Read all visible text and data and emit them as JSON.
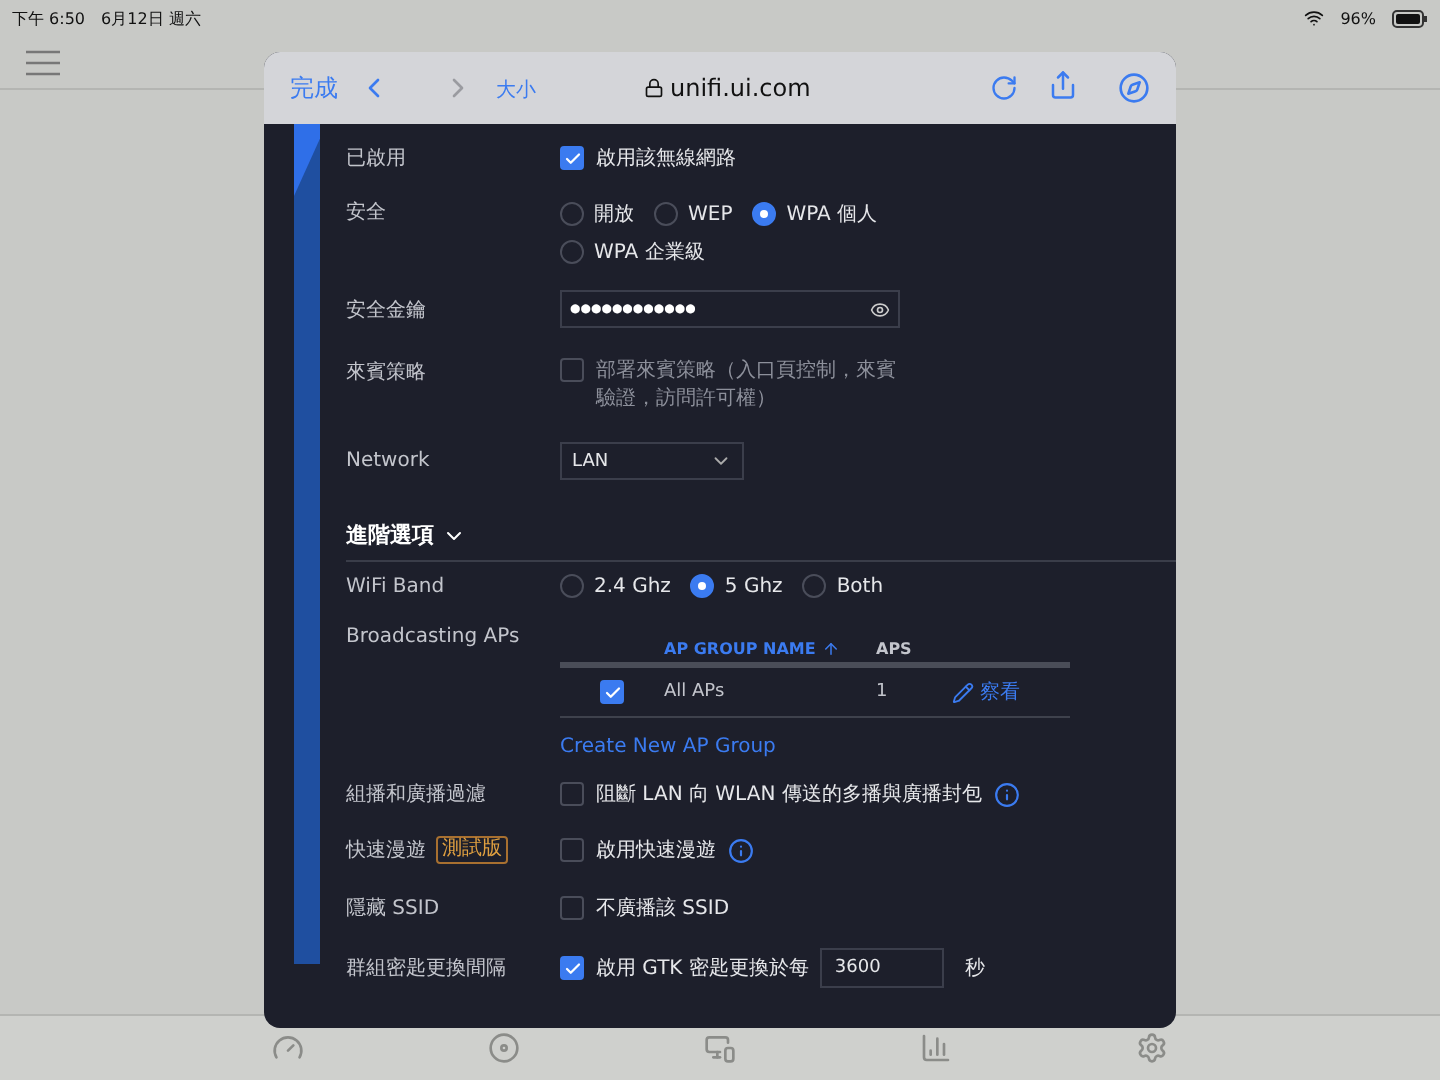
{
  "status_bar": {
    "time": "下午 6:50",
    "date": "6月12日 週六",
    "battery": "96%"
  },
  "browser": {
    "done": "完成",
    "text_size": "大小",
    "url": "unifi.ui.com"
  },
  "enabled": {
    "label": "已啟用",
    "option": "啟用該無線網路",
    "checked": true
  },
  "security": {
    "label": "安全",
    "options": [
      {
        "label": "開放",
        "selected": false
      },
      {
        "label": "WEP",
        "selected": false
      },
      {
        "label": "WPA 個人",
        "selected": true
      },
      {
        "label": "WPA 企業級",
        "selected": false
      }
    ]
  },
  "security_key": {
    "label": "安全金鑰",
    "value": "●●●●●●●●●●●●"
  },
  "guest_policy": {
    "label": "來賓策略",
    "option": "部署來賓策略（入口頁控制，來賓驗證，訪問許可權）",
    "checked": false
  },
  "network": {
    "label": "Network",
    "value": "LAN"
  },
  "advanced": {
    "title": "進階選項",
    "expanded": true
  },
  "wifi_band": {
    "label": "WiFi Band",
    "options": [
      {
        "label": "2.4 Ghz",
        "selected": false
      },
      {
        "label": "5 Ghz",
        "selected": true
      },
      {
        "label": "Both",
        "selected": false
      }
    ]
  },
  "broadcasting_aps": {
    "label": "Broadcasting APs",
    "columns": [
      "AP GROUP NAME",
      "APS"
    ],
    "rows": [
      {
        "checked": true,
        "name": "All APs",
        "aps": "1",
        "action": "察看"
      }
    ],
    "create_link": "Create New AP Group"
  },
  "settings": [
    {
      "label": "組播和廣播過濾",
      "option": "阻斷 LAN 向 WLAN 傳送的多播與廣播封包",
      "checked": false,
      "info": true
    },
    {
      "label": "快速漫遊",
      "badge": "測試版",
      "option": "啟用快速漫遊",
      "checked": false,
      "info": true
    },
    {
      "label": "隱藏 SSID",
      "option": "不廣播該 SSID",
      "checked": false,
      "info": false
    },
    {
      "label": "群組密匙更換間隔",
      "option": "啟用 GTK 密匙更換於每",
      "checked": true,
      "info": false,
      "value": "3600",
      "unit": "秒"
    }
  ]
}
